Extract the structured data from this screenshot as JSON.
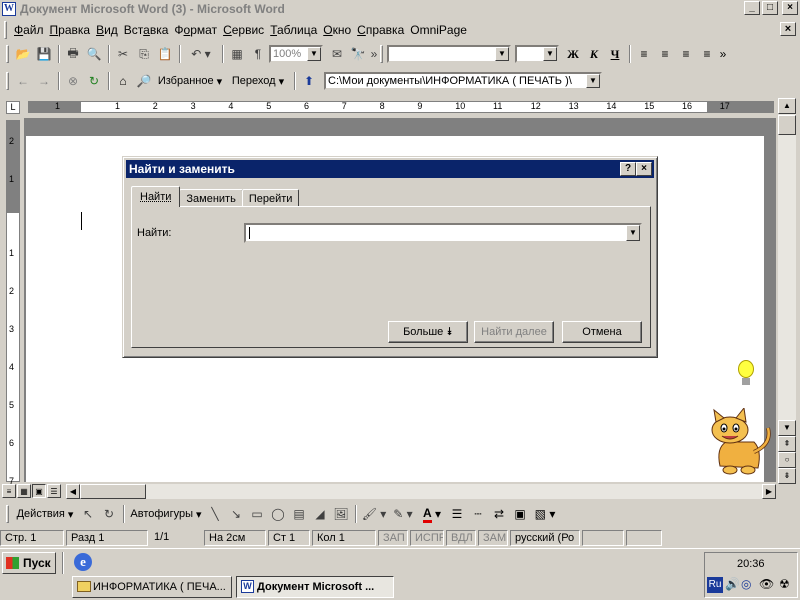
{
  "window": {
    "title": "Документ Microsoft Word (3) - Microsoft Word",
    "min": "_",
    "max": "□",
    "close": "×"
  },
  "menu": [
    {
      "ul": "Ф",
      "rest": "айл"
    },
    {
      "ul": "П",
      "rest": "равка"
    },
    {
      "ul": "В",
      "rest": "ид"
    },
    {
      "ul": "",
      "rest": "Вст",
      "ul2": "а",
      "rest2": "вка"
    },
    {
      "ul": "",
      "rest": "Ф",
      "ul2": "о",
      "rest2": "рмат"
    },
    {
      "ul": "С",
      "rest": "ервис"
    },
    {
      "ul": "Т",
      "rest": "аблица"
    },
    {
      "ul": "О",
      "rest": "кно"
    },
    {
      "ul": "С",
      "rest": "правка"
    },
    {
      "ul": "",
      "rest": "OmniPage"
    }
  ],
  "toolbar": {
    "zoom": "100%",
    "favorites": "Избранное",
    "goto": "Переход",
    "address": "C:\\Мои документы\\ИНФОРМАТИКА ( ПЕЧАТЬ )\\",
    "bold": "Ж",
    "italic": "К",
    "underline": "Ч"
  },
  "ruler": {
    "ticks": [
      "1",
      "1",
      "2",
      "3",
      "4",
      "5",
      "6",
      "7",
      "8",
      "9",
      "10",
      "11",
      "12",
      "13",
      "14",
      "15",
      "16",
      "17"
    ]
  },
  "vruler": {
    "ticks": [
      "2",
      "1",
      "1",
      "2",
      "3",
      "4",
      "5",
      "6",
      "7"
    ]
  },
  "dialog": {
    "title": "Найти и заменить",
    "help": "?",
    "close": "×",
    "tabs": [
      "Найти",
      "Заменить",
      "Перейти"
    ],
    "find_label": "Найти:",
    "find_value": "",
    "more": "Больше",
    "find_next": "Найти далее",
    "cancel": "Отмена"
  },
  "drawing": {
    "actions": "Действия",
    "autoshapes": "Автофигуры"
  },
  "status": {
    "page": "Стр. 1",
    "section": "Разд  1",
    "pages": "1/1",
    "at": "На  2см",
    "line": "Ст  1",
    "col": "Кол  1",
    "rec": "ЗАП",
    "trk": "ИСПР",
    "ext": "ВДЛ",
    "ovr": "ЗАМ",
    "lang": "русский (Ро"
  },
  "taskbar": {
    "start": "Пуск",
    "task1": "ИНФОРМАТИКА ( ПЕЧА...",
    "task2": "Документ Microsoft ...",
    "clock": "20:36",
    "lang": "Ru"
  }
}
